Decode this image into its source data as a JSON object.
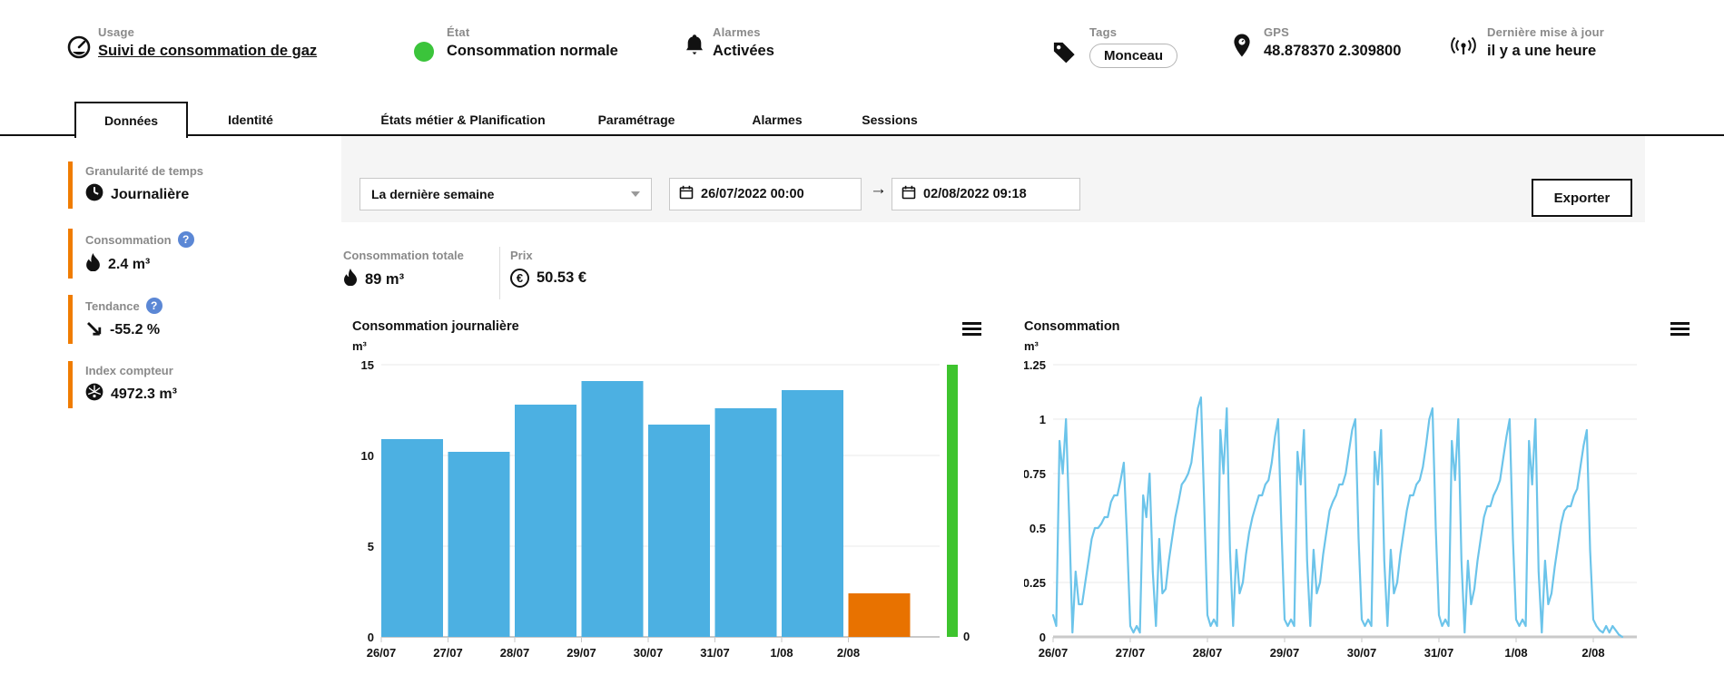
{
  "header": {
    "usage": {
      "label": "Usage",
      "value": "Suivi de consommation de gaz"
    },
    "etat": {
      "label": "État",
      "value": "Consommation normale",
      "status_color": "#3bc43b"
    },
    "alarmes": {
      "label": "Alarmes",
      "value": "Activées"
    },
    "tags": {
      "label": "Tags",
      "value": "Monceau"
    },
    "gps": {
      "label": "GPS",
      "value": "48.878370 2.309800"
    },
    "maj": {
      "label": "Dernière mise à jour",
      "value": "il y a une heure"
    }
  },
  "tabs": [
    {
      "label": "Données",
      "active": true
    },
    {
      "label": "Identité",
      "active": false
    },
    {
      "label": "États métier & Planification",
      "active": false
    },
    {
      "label": "Paramétrage",
      "active": false
    },
    {
      "label": "Alarmes",
      "active": false
    },
    {
      "label": "Sessions",
      "active": false
    }
  ],
  "sidebar": [
    {
      "label": "Granularité de temps",
      "value": "Journalière",
      "icon": "clock-icon",
      "help": false
    },
    {
      "label": "Consommation",
      "value": "2.4 m³",
      "icon": "flame-icon",
      "help": true
    },
    {
      "label": "Tendance",
      "value": "-55.2 %",
      "icon": "trend-down-icon",
      "help": true
    },
    {
      "label": "Index compteur",
      "value": "4972.3 m³",
      "icon": "meter-icon",
      "help": false
    }
  ],
  "toolbar": {
    "period_select": "La dernière semaine",
    "date_from": "26/07/2022 00:00",
    "date_to": "02/08/2022 09:18",
    "export_label": "Exporter"
  },
  "kpis": {
    "total": {
      "label": "Consommation totale",
      "value": "89 m³"
    },
    "prix": {
      "label": "Prix",
      "value": "50.53 €"
    }
  },
  "colors": {
    "accent_orange": "#f07c00",
    "bar_blue": "#4cb0e2",
    "bar_orange": "#e87200",
    "line_blue": "#6cc4ea",
    "gauge_green": "#3ec42e",
    "help_blue": "#5b87d5",
    "grid": "#e8e8e8"
  },
  "chart_data": [
    {
      "type": "bar",
      "title": "Consommation journalière",
      "ylabel": "m³",
      "categories": [
        "26/07",
        "27/07",
        "28/07",
        "29/07",
        "30/07",
        "31/07",
        "1/08",
        "2/08"
      ],
      "values": [
        10.9,
        10.2,
        12.8,
        14.1,
        11.7,
        12.6,
        13.6,
        2.4
      ],
      "bar_colors": [
        "#4cb0e2",
        "#4cb0e2",
        "#4cb0e2",
        "#4cb0e2",
        "#4cb0e2",
        "#4cb0e2",
        "#4cb0e2",
        "#e87200"
      ],
      "ylim": [
        0,
        15
      ],
      "yticks": [
        0,
        5,
        10,
        15
      ],
      "grid": true,
      "gauge": {
        "color": "#3ec42e",
        "label": "0"
      }
    },
    {
      "type": "line",
      "title": "Consommation",
      "ylabel": "m³",
      "color": "#6cc4ea",
      "ylim": [
        0,
        1.25
      ],
      "yticks": [
        0,
        0.25,
        0.5,
        0.75,
        1,
        1.25
      ],
      "grid": true,
      "x_categories": [
        "26/07",
        "27/07",
        "28/07",
        "29/07",
        "30/07",
        "31/07",
        "1/08",
        "2/08"
      ],
      "x_start": "26/07/2022 00:00",
      "interval_hours": 1,
      "values": [
        0.1,
        0.05,
        0.9,
        0.75,
        1.0,
        0.55,
        0.02,
        0.3,
        0.15,
        0.15,
        0.25,
        0.35,
        0.45,
        0.5,
        0.5,
        0.52,
        0.55,
        0.55,
        0.62,
        0.65,
        0.65,
        0.72,
        0.8,
        0.45,
        0.05,
        0.02,
        0.05,
        0.02,
        0.65,
        0.55,
        0.75,
        0.3,
        0.05,
        0.45,
        0.2,
        0.22,
        0.35,
        0.45,
        0.55,
        0.62,
        0.7,
        0.72,
        0.75,
        0.8,
        0.92,
        1.05,
        1.1,
        0.6,
        0.1,
        0.05,
        0.08,
        0.05,
        0.95,
        0.75,
        1.05,
        0.4,
        0.05,
        0.4,
        0.2,
        0.25,
        0.38,
        0.48,
        0.55,
        0.6,
        0.65,
        0.65,
        0.7,
        0.72,
        0.8,
        0.92,
        1.0,
        0.5,
        0.08,
        0.05,
        0.08,
        0.05,
        0.85,
        0.7,
        0.95,
        0.35,
        0.05,
        0.4,
        0.2,
        0.25,
        0.38,
        0.48,
        0.58,
        0.62,
        0.65,
        0.7,
        0.7,
        0.75,
        0.85,
        0.95,
        1.0,
        0.45,
        0.08,
        0.05,
        0.08,
        0.05,
        0.85,
        0.7,
        0.95,
        0.35,
        0.05,
        0.4,
        0.2,
        0.25,
        0.38,
        0.48,
        0.58,
        0.65,
        0.65,
        0.7,
        0.72,
        0.78,
        0.88,
        1.0,
        1.05,
        0.5,
        0.1,
        0.05,
        0.08,
        0.05,
        0.9,
        0.72,
        1.0,
        0.35,
        0.02,
        0.35,
        0.15,
        0.22,
        0.35,
        0.45,
        0.55,
        0.6,
        0.6,
        0.65,
        0.68,
        0.72,
        0.82,
        0.92,
        1.0,
        0.45,
        0.08,
        0.05,
        0.08,
        0.05,
        0.9,
        0.7,
        1.0,
        0.3,
        0.02,
        0.35,
        0.15,
        0.2,
        0.32,
        0.42,
        0.52,
        0.58,
        0.6,
        0.6,
        0.65,
        0.68,
        0.78,
        0.88,
        0.95,
        0.4,
        0.08,
        0.05,
        0.03,
        0.02,
        0.05,
        0.02,
        0.05,
        0.03,
        0.01,
        0.0
      ]
    }
  ]
}
